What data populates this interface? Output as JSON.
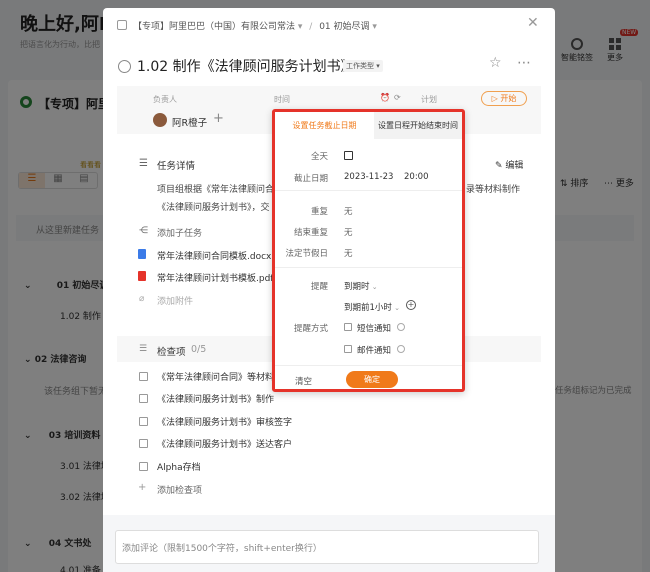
{
  "background": {
    "greeting": "晚上好,阿R",
    "subtitle": "把语言化为行动，比把",
    "project_title": "【专项】阿里",
    "view_label": "看看看",
    "new_task_hint": "从这里新建任务",
    "groups": [
      {
        "label": "01 初始尽调",
        "sub": "1.02 制作"
      },
      {
        "label": "02 法律咨询",
        "sub": "该任务组下暂无"
      },
      {
        "label": "03 培训资料",
        "sub": "3.01 法律培"
      },
      {
        "label": "",
        "sub": "3.02 法律培"
      },
      {
        "label": "04 文书处",
        "sub": "4.01 准备"
      }
    ],
    "right_buttons": [
      {
        "label": "智能铭签"
      },
      {
        "label": "更多",
        "badge": "NEW"
      }
    ],
    "toolbar_right": {
      "sort": "排序",
      "more": "更多"
    },
    "group_hint": "任务组标记为已完成"
  },
  "modal": {
    "breadcrumb_project": "【专项】阿里巴巴（中国）有限公司常法",
    "breadcrumb_sep": "/",
    "breadcrumb_group": "01 初始尽调",
    "task_title": "1.02 制作《法律顾问服务计划书》",
    "task_type": "工作类型",
    "header_assignee": "负责人",
    "header_time": "时间",
    "header_plan": "计划",
    "start_button": "开始",
    "assignee_name": "阿R橙子",
    "details_label": "任务详情",
    "edit_label": "编辑",
    "details_text_1": "项目组根据《常年法律顾问合",
    "details_text_1_tail": "录等材料制作",
    "details_text_2": "《法律顾问服务计划书》，交",
    "add_subtask": "添加子任务",
    "attachments": [
      "常年法律顾问合同模板.docx",
      "常年法律顾问计划书模板.pdf"
    ],
    "add_attachment": "添加附件",
    "checklist_label": "检查项",
    "checklist_count": "0/5",
    "checklist_items": [
      "《常年法律顾问合同》等材料",
      "《法律顾问服务计划书》制作",
      "《法律顾问服务计划书》审核签字",
      "《法律顾问服务计划书》送达客户",
      "Alpha存档"
    ],
    "add_checklist": "添加检查项",
    "comment_placeholder": "添加评论（限制1500个字符，shift+enter换行）"
  },
  "popup": {
    "tab_deadline": "设置任务截止日期",
    "tab_schedule": "设置日程开始结束时间",
    "allday_label": "全天",
    "deadline_label": "截止日期",
    "deadline_date": "2023-11-23",
    "deadline_time": "20:00",
    "repeat_label": "重复",
    "repeat_value": "无",
    "end_repeat_label": "结束重复",
    "end_repeat_value": "无",
    "holiday_label": "法定节假日",
    "holiday_value": "无",
    "remind_label": "提醒",
    "remind_value_1": "到期时",
    "remind_value_2": "到期前1小时",
    "remind_method_label": "提醒方式",
    "sms_label": "短信通知",
    "email_label": "邮件通知",
    "clear_label": "清空",
    "confirm_label": "确定"
  },
  "colors": {
    "accent": "#f07a1a",
    "highlight": "#e5332a"
  }
}
